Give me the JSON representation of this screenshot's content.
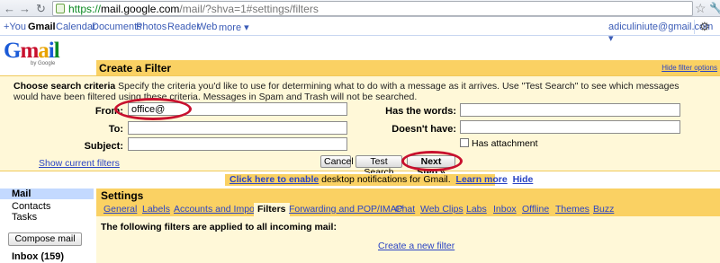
{
  "browser": {
    "url_scheme": "https://",
    "url_host": "mail.google.com",
    "url_path": "/mail/?shva=1#settings/filters",
    "back_icon": "back-arrow-icon",
    "forward_icon": "forward-arrow-icon",
    "reload_icon": "reload-icon"
  },
  "gbar": {
    "links": [
      "+You",
      "Gmail",
      "Calendar",
      "Documents",
      "Photos",
      "Reader",
      "Web",
      "more ▾"
    ],
    "current": "Gmail",
    "user": "adiculiniute@gmail.com ▾"
  },
  "logo": {
    "text": "Gmail",
    "sub": "by Google"
  },
  "create_filter": {
    "title": "Create a Filter",
    "hide_link": "Hide filter options",
    "desc_bold": "Choose search criteria",
    "desc_rest": " Specify the criteria you'd like to use for determining what to do with a message as it arrives. Use \"Test Search\" to see which messages would have been filtered using these criteria. Messages in Spam and Trash will not be searched.",
    "from_label": "From:",
    "from_value": "office@",
    "to_label": "To:",
    "to_value": "",
    "subject_label": "Subject:",
    "subject_value": "",
    "has_words_label": "Has the words:",
    "has_words_value": "",
    "doesnt_have_label": "Doesn't have:",
    "doesnt_have_value": "",
    "has_attachment_label": "Has attachment",
    "has_attachment_checked": false,
    "show_filters_link": "Show current filters",
    "cancel_label": "Cancel",
    "test_search_label": "Test Search",
    "next_step_label": "Next Step »"
  },
  "notification": {
    "link": "Click here to enable",
    "text": " desktop notifications for Gmail.",
    "learn_more": "Learn more",
    "hide": "Hide"
  },
  "sidebar": {
    "mail": "Mail",
    "contacts": "Contacts",
    "tasks": "Tasks",
    "compose": "Compose mail",
    "inbox": "Inbox (159)"
  },
  "settings": {
    "title": "Settings",
    "tabs": [
      "General",
      "Labels",
      "Accounts and Import",
      "Filters",
      "Forwarding and POP/IMAP",
      "Chat",
      "Web Clips",
      "Labs",
      "Inbox",
      "Offline",
      "Themes",
      "Buzz"
    ],
    "current_tab": "Filters",
    "message": "The following filters are applied to all incoming mail:",
    "create_link": "Create a new filter"
  },
  "colors": {
    "accent": "#fad163",
    "panel": "#fff8d8",
    "link": "#2a44c4",
    "highlight_circle": "#c8102e",
    "nav_selected": "#c3d9ff"
  }
}
